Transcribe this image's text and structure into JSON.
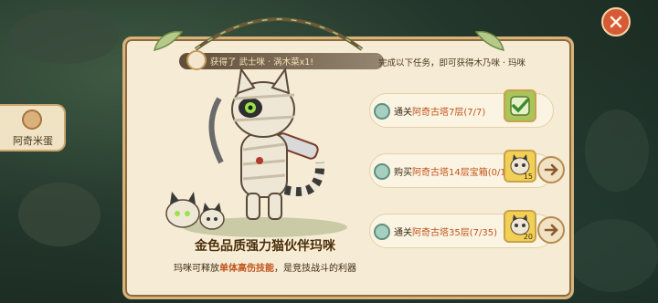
{
  "side_tab": {
    "label": "阿奇米蛋"
  },
  "notice": {
    "text": "获得了 武士咪 · 涡木菜x1!"
  },
  "task_header": "完成以下任务，即可获得木乃咪 · 玛咪",
  "tasks": [
    {
      "prefix": "通关",
      "target": "阿奇古塔7层",
      "progress": "(7/7)",
      "reward_count": "",
      "state": "done"
    },
    {
      "prefix": "购买",
      "target": "阿奇古塔14层宝箱",
      "progress": "(0/1)",
      "reward_count": "15",
      "state": "todo"
    },
    {
      "prefix": "通关",
      "target": "阿奇古塔35层",
      "progress": "(7/35)",
      "reward_count": "20",
      "state": "todo"
    }
  ],
  "title": "金色品质强力猫伙伴玛咪",
  "description": {
    "before": "玛咪可释放",
    "highlight": "单体高伤技能",
    "after": "，是竞技战斗的利器"
  },
  "colors": {
    "accent": "#c0541c",
    "panel": "#f6ecd5",
    "border": "#d7b47b",
    "close": "#d65a35"
  },
  "icons": [
    "close-icon",
    "check-icon",
    "arrow-right-icon",
    "task-icon",
    "mummy-cat-icon"
  ]
}
